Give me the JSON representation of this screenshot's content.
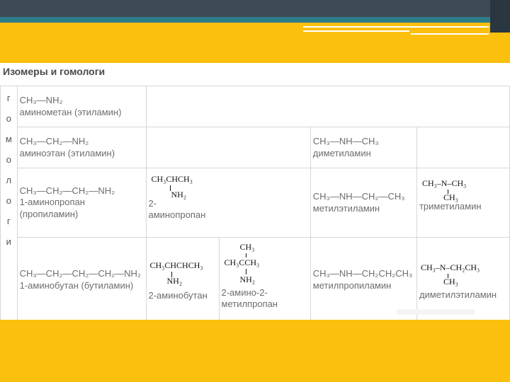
{
  "heading": "Изомеры и гомологи",
  "side_letters": [
    "г",
    "о",
    "м",
    "о",
    "л",
    "о",
    "г",
    "и"
  ],
  "rows": [
    {
      "c1_formula": "CH₃—NH₂",
      "c1_name": "аминометан (этиламин)"
    },
    {
      "c1_formula": "CH₃—CH₂—NH₂",
      "c1_name": "аминоэтан (этиламин)",
      "c4_formula": "CH₃—NH—CH₃",
      "c4_name": "диметиламин"
    },
    {
      "c1_formula": "CH₃—CH₂—CH₂—NH₂",
      "c1_name": "1-аминопропан",
      "c1_name2": "(пропиламин)",
      "c2_struct_top": "CH₃CHCH₃",
      "c2_struct_bottom": "NH₂",
      "c2_name": "2-",
      "c2_name2": "аминопропан",
      "c4_formula": "CH₃—NH—CH₂—CH₃",
      "c4_name": "метилэтиламин",
      "c5_struct_top": "CH₃–N–CH₃",
      "c5_struct_bottom": "CH₃",
      "c5_name": "триметиламин"
    },
    {
      "c1_formula": "CH₃—CH₂—CH₂—CH₂—NH₂",
      "c1_name": "1-аминобутан (бутиламин)",
      "c2_struct_top": "CH₃CHCHCH₃",
      "c2_struct_bottom": "NH₂",
      "c2_name": "2-аминобутан",
      "c3_struct_top": "CH₃",
      "c3_struct_mid": "CH₃CCH₃",
      "c3_struct_bottom": "NH₂",
      "c3_name": "2-амино-2-",
      "c3_name2": "метилпропан",
      "c4_formula": "CH₃—NH—CH₂CH₂CH₃",
      "c4_name": "метилпропиламин",
      "c5_struct_top": "CH₃–N–CH₂CH₃",
      "c5_struct_bottom": "CH₃",
      "c5_name": "диметилэтиламин"
    }
  ],
  "colors": {
    "accent_yellow": "#fbbf0d",
    "top_bar": "#3e4b57",
    "teal_band": "#2e7d8a"
  }
}
